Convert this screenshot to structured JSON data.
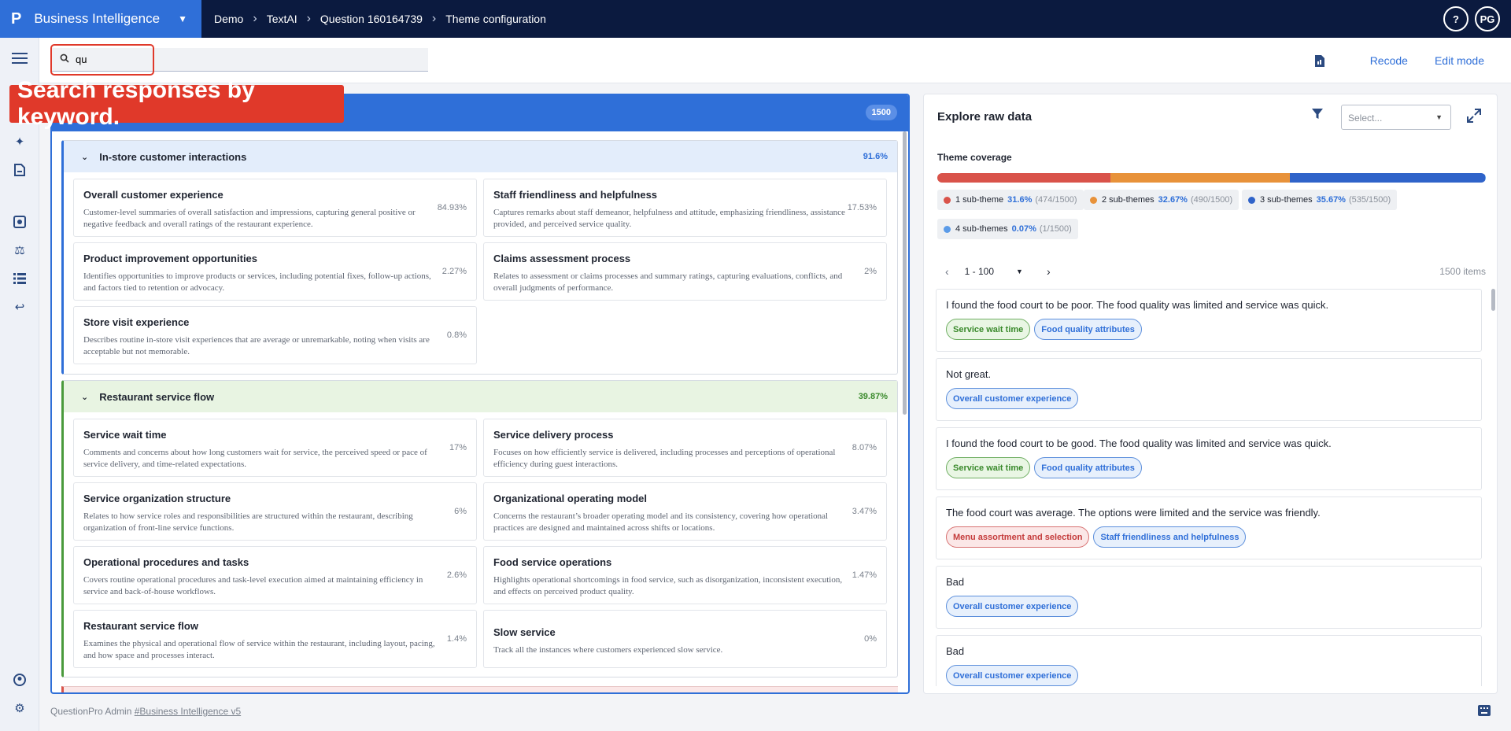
{
  "app": {
    "logo": "P",
    "name": "Business Intelligence"
  },
  "breadcrumb": [
    "Demo",
    "TextAI",
    "Question 160164739",
    "Theme configuration"
  ],
  "user": {
    "help": "?",
    "initials": "PG"
  },
  "search": {
    "value": "qu",
    "placeholder": ""
  },
  "toolbar": {
    "recode_label": "Recode",
    "edit_mode_label": "Edit mode"
  },
  "callout": "Search responses by keyword.",
  "left_panel": {
    "count": "1500",
    "groups": [
      {
        "title": "In-store customer interactions",
        "pct": "91.6%",
        "color": "#2f6fd8",
        "cards": [
          {
            "title": "Overall customer experience",
            "desc": "Customer-level summaries of overall satisfaction and impressions, capturing general positive or negative feedback and overall ratings of the restaurant experience.",
            "pct": "84.93%"
          },
          {
            "title": "Staff friendliness and helpfulness",
            "desc": "Captures remarks about staff demeanor, helpfulness and attitude, emphasizing friendliness, assistance provided, and perceived service quality.",
            "pct": "17.53%"
          },
          {
            "title": "Product improvement opportunities",
            "desc": "Identifies opportunities to improve products or services, including potential fixes, follow-up actions, and factors tied to retention or advocacy.",
            "pct": "2.27%"
          },
          {
            "title": "Claims assessment process",
            "desc": "Relates to assessment or claims processes and summary ratings, capturing evaluations, conflicts, and overall judgments of performance.",
            "pct": "2%"
          },
          {
            "title": "Store visit experience",
            "desc": "Describes routine in-store visit experiences that are average or unremarkable, noting when visits are acceptable but not memorable.",
            "pct": "0.8%"
          }
        ]
      },
      {
        "title": "Restaurant service flow",
        "pct": "39.87%",
        "color": "#4a9a3c",
        "cards": [
          {
            "title": "Service wait time",
            "desc": "Comments and concerns about how long customers wait for service, the perceived speed or pace of service delivery, and time-related expectations.",
            "pct": "17%"
          },
          {
            "title": "Service delivery process",
            "desc": "Focuses on how efficiently service is delivered, including processes and perceptions of operational efficiency during guest interactions.",
            "pct": "8.07%"
          },
          {
            "title": "Service organization structure",
            "desc": "Relates to how service roles and responsibilities are structured within the restaurant, describing organization of front-line service functions.",
            "pct": "6%"
          },
          {
            "title": "Organizational operating model",
            "desc": "Concerns the restaurant’s broader operating model and its consistency, covering how operational practices are designed and maintained across shifts or locations.",
            "pct": "3.47%"
          },
          {
            "title": "Operational procedures and tasks",
            "desc": "Covers routine operational procedures and task-level execution aimed at maintaining efficiency in service and back-of-house workflows.",
            "pct": "2.6%"
          },
          {
            "title": "Food service operations",
            "desc": "Highlights operational shortcomings in food service, such as disorganization, inconsistent execution, and effects on perceived product quality.",
            "pct": "1.47%"
          },
          {
            "title": "Restaurant service flow",
            "desc": "Examines the physical and operational flow of service within the restaurant, including layout, pacing, and how space and processes interact.",
            "pct": "1.4%"
          },
          {
            "title": "Slow service",
            "desc": "Track all the instances where customers experienced slow service.",
            "pct": "0%"
          }
        ]
      }
    ]
  },
  "right_panel": {
    "title": "Explore raw data",
    "select_placeholder": "Select...",
    "coverage_label": "Theme coverage",
    "coverage": [
      {
        "label": "1 sub-theme",
        "pct": "31.6%",
        "count": "(474/1500)",
        "value": 31.6,
        "color": "#d9534a"
      },
      {
        "label": "2 sub-themes",
        "pct": "32.67%",
        "count": "(490/1500)",
        "value": 32.67,
        "color": "#e8923a"
      },
      {
        "label": "3 sub-themes",
        "pct": "35.67%",
        "count": "(535/1500)",
        "value": 35.67,
        "color": "#2f63c9"
      },
      {
        "label": "4 sub-themes",
        "pct": "0.07%",
        "count": "(1/1500)",
        "value": 0.07,
        "color": "#5b9be8"
      }
    ],
    "pager": {
      "range": "1 - 100",
      "items": "1500 items"
    },
    "responses": [
      {
        "text": "I found the food court to be poor. The food quality was limited and service was quick.",
        "tags": [
          {
            "label": "Service wait time",
            "kind": "green"
          },
          {
            "label": "Food quality attributes",
            "kind": "blue"
          }
        ]
      },
      {
        "text": "Not great.",
        "tags": [
          {
            "label": "Overall customer experience",
            "kind": "blue"
          }
        ]
      },
      {
        "text": "I found the food court to be good. The food quality was limited and service was quick.",
        "tags": [
          {
            "label": "Service wait time",
            "kind": "green"
          },
          {
            "label": "Food quality attributes",
            "kind": "blue"
          }
        ]
      },
      {
        "text": "The food court was average. The options were limited and the service was friendly.",
        "tags": [
          {
            "label": "Menu assortment and selection",
            "kind": "red"
          },
          {
            "label": "Staff friendliness and helpfulness",
            "kind": "blue"
          }
        ]
      },
      {
        "text": "Bad",
        "tags": [
          {
            "label": "Overall customer experience",
            "kind": "blue"
          }
        ]
      },
      {
        "text": "Bad",
        "tags": [
          {
            "label": "Overall customer experience",
            "kind": "blue"
          }
        ]
      }
    ]
  },
  "footer": {
    "text": "QuestionPro Admin",
    "link": "#Business Intelligence v5"
  }
}
